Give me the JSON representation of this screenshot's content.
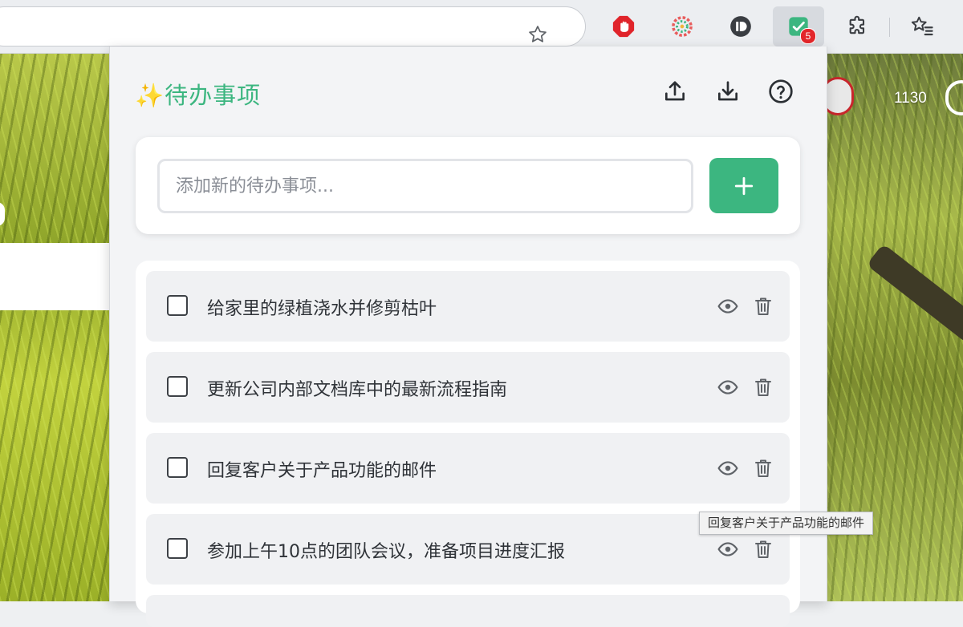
{
  "browser": {
    "extensions": [
      {
        "name": "adblock",
        "color": "#e0242b"
      },
      {
        "name": "color-wheel",
        "color": "#3cb680"
      },
      {
        "name": "dark-circle",
        "color": "#3a3d42"
      },
      {
        "name": "todo",
        "color": "#3cb680",
        "badge": "5"
      },
      {
        "name": "puzzle",
        "color": "#3a3d42"
      }
    ]
  },
  "page": {
    "score": "1130"
  },
  "popup": {
    "title": "✨待办事项",
    "add_placeholder": "添加新的待办事项...",
    "add_label": "+",
    "accent": "#3cb680",
    "todos": [
      {
        "text": "给家里的绿植浇水并修剪枯叶",
        "done": false
      },
      {
        "text": "更新公司内部文档库中的最新流程指南",
        "done": false
      },
      {
        "text": "回复客户关于产品功能的邮件",
        "done": false
      },
      {
        "text": "参加上午10点的团队会议，准备项目进度汇报",
        "done": false
      }
    ],
    "tooltip": "回复客户关于产品功能的邮件"
  }
}
